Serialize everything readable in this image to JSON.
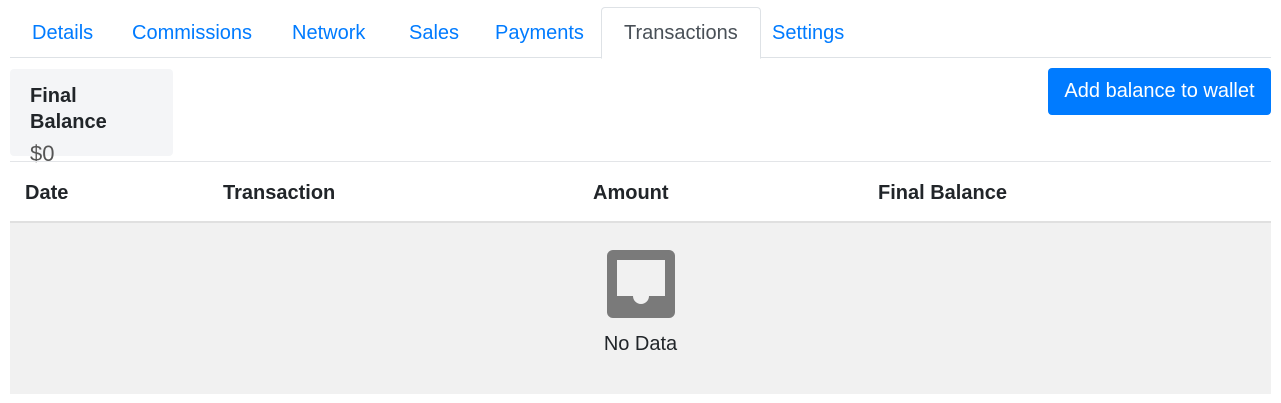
{
  "tabs": [
    {
      "label": "Details",
      "active": false
    },
    {
      "label": "Commissions",
      "active": false
    },
    {
      "label": "Network",
      "active": false
    },
    {
      "label": "Sales",
      "active": false
    },
    {
      "label": "Payments",
      "active": false
    },
    {
      "label": "Transactions",
      "active": true
    },
    {
      "label": "Settings",
      "active": false
    }
  ],
  "balance": {
    "label": "Final Balance",
    "value": "$0"
  },
  "add_button": {
    "label": "Add balance to wallet"
  },
  "table": {
    "columns": [
      "Date",
      "Transaction",
      "Amount",
      "Final Balance"
    ],
    "rows": [],
    "empty_text": "No Data",
    "empty_icon": "empty-inbox-icon"
  },
  "colors": {
    "accent": "#007bff",
    "active_tab_text": "#495057",
    "empty_bg": "#f1f1f1",
    "icon": "#7a7a7a"
  }
}
